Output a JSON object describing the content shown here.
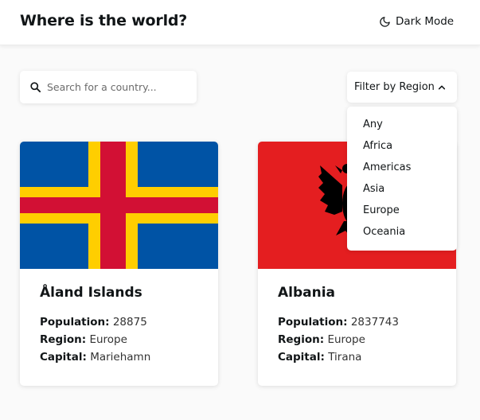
{
  "header": {
    "title": "Where is the world?",
    "dark_mode_label": "Dark Mode"
  },
  "search": {
    "placeholder": "Search for a country...",
    "value": ""
  },
  "filter": {
    "label": "Filter by Region",
    "options": [
      "Any",
      "Africa",
      "Americas",
      "Asia",
      "Europe",
      "Oceania"
    ]
  },
  "labels": {
    "population": "Population:",
    "region": "Region:",
    "capital": "Capital:"
  },
  "countries": [
    {
      "name": "Åland Islands",
      "population": "28875",
      "region": "Europe",
      "capital": "Mariehamn"
    },
    {
      "name": "Albania",
      "population": "2837743",
      "region": "Europe",
      "capital": "Tirana"
    }
  ],
  "colors": {
    "background": "#fafafa",
    "text": "#111517",
    "aland_blue": "#0053a5",
    "aland_yellow": "#ffce00",
    "aland_red": "#d21034",
    "albania_red": "#e41e20"
  }
}
